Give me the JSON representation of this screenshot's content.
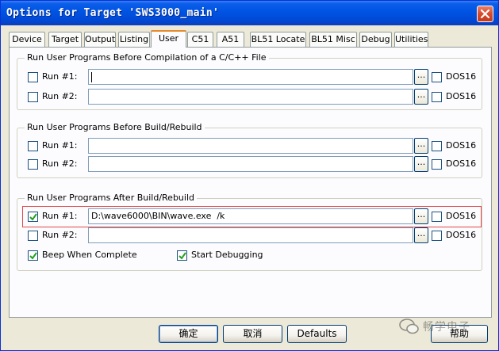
{
  "window": {
    "title": "Options for Target 'SWS3000_main'"
  },
  "tabs": [
    {
      "label": "Device"
    },
    {
      "label": "Target"
    },
    {
      "label": "Output"
    },
    {
      "label": "Listing"
    },
    {
      "label": "User",
      "active": true
    },
    {
      "label": "C51"
    },
    {
      "label": "A51"
    },
    {
      "label": "BL51 Locate"
    },
    {
      "label": "BL51 Misc"
    },
    {
      "label": "Debug"
    },
    {
      "label": "Utilities"
    }
  ],
  "groups": [
    {
      "title": "Run User Programs Before Compilation of a C/C++ File",
      "rows": [
        {
          "label": "Run #1:",
          "checked": false,
          "value": "",
          "dos16": "DOS16",
          "dos16_checked": false
        },
        {
          "label": "Run #2:",
          "checked": false,
          "value": "",
          "dos16": "DOS16",
          "dos16_checked": false
        }
      ]
    },
    {
      "title": "Run User Programs Before Build/Rebuild",
      "rows": [
        {
          "label": "Run #1:",
          "checked": false,
          "value": "",
          "dos16": "DOS16",
          "dos16_checked": false
        },
        {
          "label": "Run #2:",
          "checked": false,
          "value": "",
          "dos16": "DOS16",
          "dos16_checked": false
        }
      ]
    },
    {
      "title": "Run User Programs After Build/Rebuild",
      "rows": [
        {
          "label": "Run #1:",
          "checked": true,
          "value": "D:\\wave6000\\BIN\\wave.exe  /k",
          "dos16": "DOS16",
          "dos16_checked": false
        },
        {
          "label": "Run #2:",
          "checked": false,
          "value": "",
          "dos16": "DOS16",
          "dos16_checked": false
        }
      ],
      "options": [
        {
          "label": "Beep When Complete",
          "checked": true
        },
        {
          "label": "Start Debugging",
          "checked": true
        }
      ]
    }
  ],
  "browse_label": "...",
  "buttons": {
    "ok": "确定",
    "cancel": "取消",
    "defaults": "Defaults",
    "help": "帮助"
  },
  "watermark": {
    "text": "畅学电子"
  },
  "colors": {
    "titlebar": "#0054e3",
    "active_tab_accent": "#e68b2c",
    "highlight_box": "#e04848"
  }
}
